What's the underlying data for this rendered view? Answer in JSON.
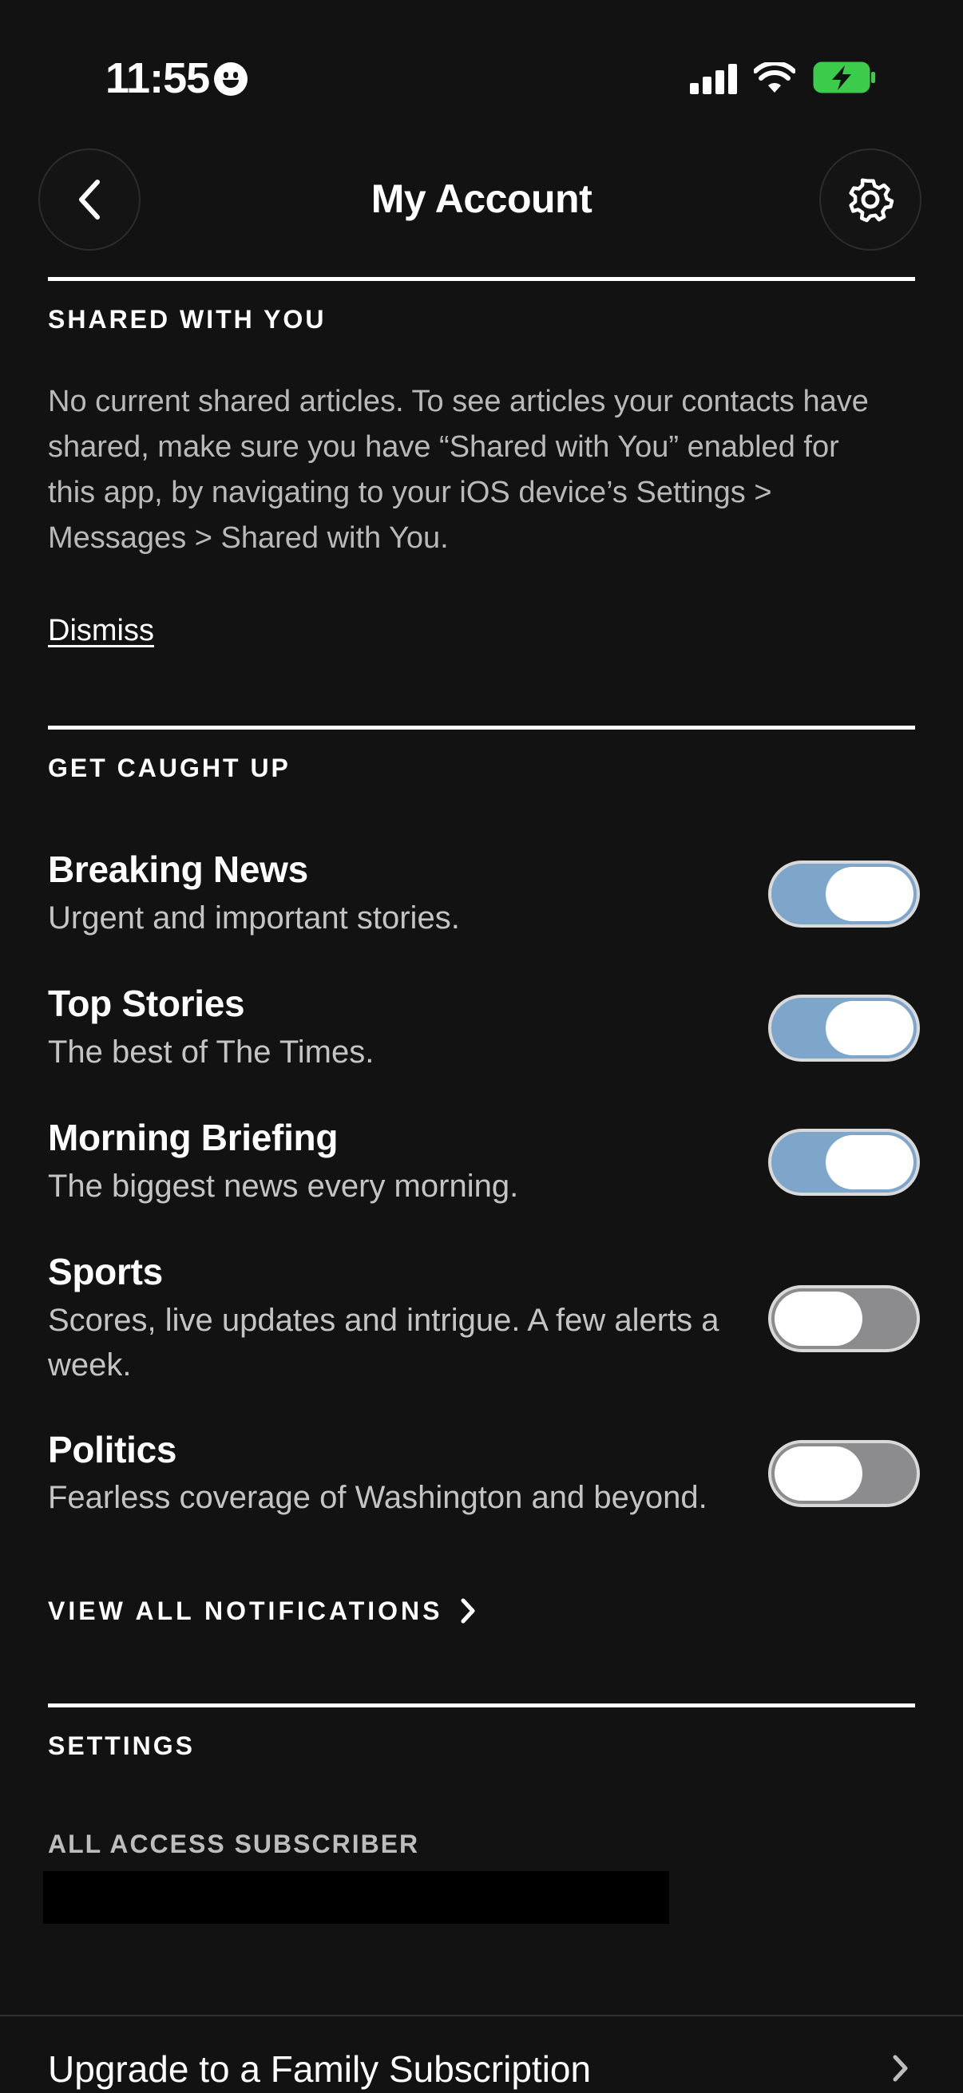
{
  "status_bar": {
    "time": "11:55"
  },
  "header": {
    "title": "My Account"
  },
  "shared": {
    "label": "SHARED WITH YOU",
    "lines": [
      "No current shared articles. To see articles your contacts have",
      "shared, make sure you have “Shared with You” enabled for",
      "this app, by navigating to your iOS device’s Settings >",
      "Messages > Shared with You."
    ],
    "dismiss": "Dismiss"
  },
  "caught_up": {
    "label": "GET CAUGHT UP",
    "items": [
      {
        "title": "Breaking News",
        "sub": "Urgent and important stories.",
        "enabled": true
      },
      {
        "title": "Top Stories",
        "sub": "The best of The Times.",
        "enabled": true
      },
      {
        "title": "Morning Briefing",
        "sub": "The biggest news every morning.",
        "enabled": true
      },
      {
        "title": "Sports",
        "sub": "Scores, live updates and intrigue. A few alerts a week.",
        "enabled": false
      },
      {
        "title": "Politics",
        "sub": "Fearless coverage of Washington and beyond.",
        "enabled": false
      }
    ],
    "view_all": "VIEW ALL NOTIFICATIONS"
  },
  "settings": {
    "label": "SETTINGS",
    "subscriber_label": "ALL ACCESS SUBSCRIBER",
    "upgrade": "Upgrade to a Family Subscription"
  },
  "colors": {
    "background": "#121212",
    "toggle_on": "#7ea6cb",
    "toggle_off": "#8c8c8e",
    "battery": "#3ccb4a"
  },
  "icons": [
    "emoji-face-icon",
    "signal-icon",
    "wifi-icon",
    "battery-charging-icon",
    "back-chevron-icon",
    "gear-icon",
    "chevron-right-icon"
  ]
}
